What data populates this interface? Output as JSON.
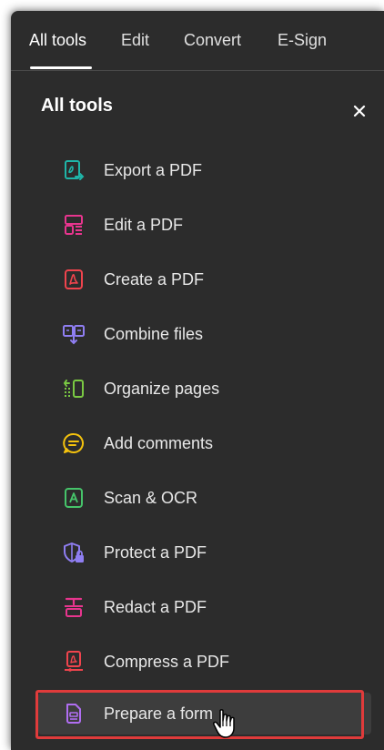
{
  "tabs": [
    {
      "label": "All tools",
      "active": true
    },
    {
      "label": "Edit",
      "active": false
    },
    {
      "label": "Convert",
      "active": false
    },
    {
      "label": "E-Sign",
      "active": false
    }
  ],
  "panel": {
    "title": "All tools",
    "close_icon": "close-icon"
  },
  "tools": [
    {
      "label": "Export a PDF",
      "icon": "export-pdf-icon",
      "color": "#1fb5a8"
    },
    {
      "label": "Edit a PDF",
      "icon": "edit-pdf-icon",
      "color": "#e8358e"
    },
    {
      "label": "Create a PDF",
      "icon": "create-pdf-icon",
      "color": "#f0444d"
    },
    {
      "label": "Combine files",
      "icon": "combine-files-icon",
      "color": "#8f7ef2"
    },
    {
      "label": "Organize pages",
      "icon": "organize-pages-icon",
      "color": "#7ac943"
    },
    {
      "label": "Add comments",
      "icon": "add-comments-icon",
      "color": "#f4c20d"
    },
    {
      "label": "Scan & OCR",
      "icon": "scan-ocr-icon",
      "color": "#46c46a"
    },
    {
      "label": "Protect a PDF",
      "icon": "protect-pdf-icon",
      "color": "#8f7ef2"
    },
    {
      "label": "Redact a PDF",
      "icon": "redact-pdf-icon",
      "color": "#e8358e"
    },
    {
      "label": "Compress a PDF",
      "icon": "compress-pdf-icon",
      "color": "#f0444d"
    },
    {
      "label": "Prepare a form",
      "icon": "prepare-form-icon",
      "color": "#b06ef2",
      "hovered": true,
      "highlighted": true
    }
  ],
  "colors": {
    "panel_bg": "#2c2c2c",
    "highlight_border": "#e03b3b",
    "hover_bg": "#3d3d3d"
  }
}
